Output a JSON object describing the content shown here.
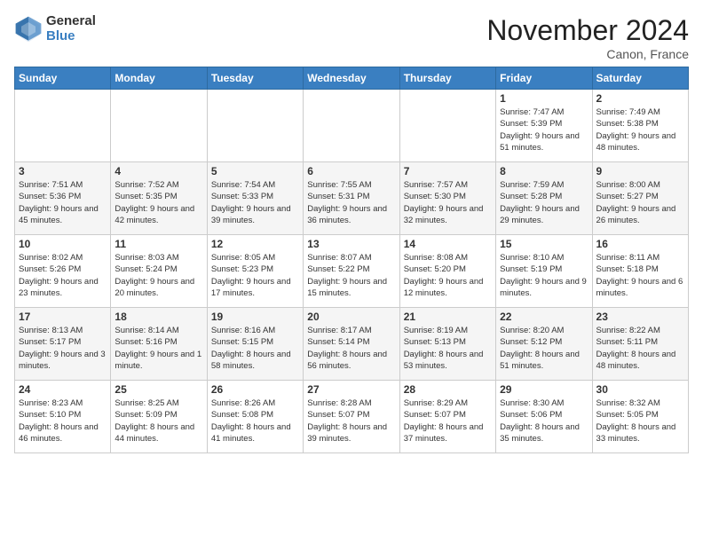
{
  "header": {
    "logo_general": "General",
    "logo_blue": "Blue",
    "title": "November 2024",
    "location": "Canon, France"
  },
  "days_of_week": [
    "Sunday",
    "Monday",
    "Tuesday",
    "Wednesday",
    "Thursday",
    "Friday",
    "Saturday"
  ],
  "weeks": [
    [
      {
        "day": "",
        "info": ""
      },
      {
        "day": "",
        "info": ""
      },
      {
        "day": "",
        "info": ""
      },
      {
        "day": "",
        "info": ""
      },
      {
        "day": "",
        "info": ""
      },
      {
        "day": "1",
        "info": "Sunrise: 7:47 AM\nSunset: 5:39 PM\nDaylight: 9 hours\nand 51 minutes."
      },
      {
        "day": "2",
        "info": "Sunrise: 7:49 AM\nSunset: 5:38 PM\nDaylight: 9 hours\nand 48 minutes."
      }
    ],
    [
      {
        "day": "3",
        "info": "Sunrise: 7:51 AM\nSunset: 5:36 PM\nDaylight: 9 hours\nand 45 minutes."
      },
      {
        "day": "4",
        "info": "Sunrise: 7:52 AM\nSunset: 5:35 PM\nDaylight: 9 hours\nand 42 minutes."
      },
      {
        "day": "5",
        "info": "Sunrise: 7:54 AM\nSunset: 5:33 PM\nDaylight: 9 hours\nand 39 minutes."
      },
      {
        "day": "6",
        "info": "Sunrise: 7:55 AM\nSunset: 5:31 PM\nDaylight: 9 hours\nand 36 minutes."
      },
      {
        "day": "7",
        "info": "Sunrise: 7:57 AM\nSunset: 5:30 PM\nDaylight: 9 hours\nand 32 minutes."
      },
      {
        "day": "8",
        "info": "Sunrise: 7:59 AM\nSunset: 5:28 PM\nDaylight: 9 hours\nand 29 minutes."
      },
      {
        "day": "9",
        "info": "Sunrise: 8:00 AM\nSunset: 5:27 PM\nDaylight: 9 hours\nand 26 minutes."
      }
    ],
    [
      {
        "day": "10",
        "info": "Sunrise: 8:02 AM\nSunset: 5:26 PM\nDaylight: 9 hours\nand 23 minutes."
      },
      {
        "day": "11",
        "info": "Sunrise: 8:03 AM\nSunset: 5:24 PM\nDaylight: 9 hours\nand 20 minutes."
      },
      {
        "day": "12",
        "info": "Sunrise: 8:05 AM\nSunset: 5:23 PM\nDaylight: 9 hours\nand 17 minutes."
      },
      {
        "day": "13",
        "info": "Sunrise: 8:07 AM\nSunset: 5:22 PM\nDaylight: 9 hours\nand 15 minutes."
      },
      {
        "day": "14",
        "info": "Sunrise: 8:08 AM\nSunset: 5:20 PM\nDaylight: 9 hours\nand 12 minutes."
      },
      {
        "day": "15",
        "info": "Sunrise: 8:10 AM\nSunset: 5:19 PM\nDaylight: 9 hours\nand 9 minutes."
      },
      {
        "day": "16",
        "info": "Sunrise: 8:11 AM\nSunset: 5:18 PM\nDaylight: 9 hours\nand 6 minutes."
      }
    ],
    [
      {
        "day": "17",
        "info": "Sunrise: 8:13 AM\nSunset: 5:17 PM\nDaylight: 9 hours\nand 3 minutes."
      },
      {
        "day": "18",
        "info": "Sunrise: 8:14 AM\nSunset: 5:16 PM\nDaylight: 9 hours\nand 1 minute."
      },
      {
        "day": "19",
        "info": "Sunrise: 8:16 AM\nSunset: 5:15 PM\nDaylight: 8 hours\nand 58 minutes."
      },
      {
        "day": "20",
        "info": "Sunrise: 8:17 AM\nSunset: 5:14 PM\nDaylight: 8 hours\nand 56 minutes."
      },
      {
        "day": "21",
        "info": "Sunrise: 8:19 AM\nSunset: 5:13 PM\nDaylight: 8 hours\nand 53 minutes."
      },
      {
        "day": "22",
        "info": "Sunrise: 8:20 AM\nSunset: 5:12 PM\nDaylight: 8 hours\nand 51 minutes."
      },
      {
        "day": "23",
        "info": "Sunrise: 8:22 AM\nSunset: 5:11 PM\nDaylight: 8 hours\nand 48 minutes."
      }
    ],
    [
      {
        "day": "24",
        "info": "Sunrise: 8:23 AM\nSunset: 5:10 PM\nDaylight: 8 hours\nand 46 minutes."
      },
      {
        "day": "25",
        "info": "Sunrise: 8:25 AM\nSunset: 5:09 PM\nDaylight: 8 hours\nand 44 minutes."
      },
      {
        "day": "26",
        "info": "Sunrise: 8:26 AM\nSunset: 5:08 PM\nDaylight: 8 hours\nand 41 minutes."
      },
      {
        "day": "27",
        "info": "Sunrise: 8:28 AM\nSunset: 5:07 PM\nDaylight: 8 hours\nand 39 minutes."
      },
      {
        "day": "28",
        "info": "Sunrise: 8:29 AM\nSunset: 5:07 PM\nDaylight: 8 hours\nand 37 minutes."
      },
      {
        "day": "29",
        "info": "Sunrise: 8:30 AM\nSunset: 5:06 PM\nDaylight: 8 hours\nand 35 minutes."
      },
      {
        "day": "30",
        "info": "Sunrise: 8:32 AM\nSunset: 5:05 PM\nDaylight: 8 hours\nand 33 minutes."
      }
    ]
  ]
}
